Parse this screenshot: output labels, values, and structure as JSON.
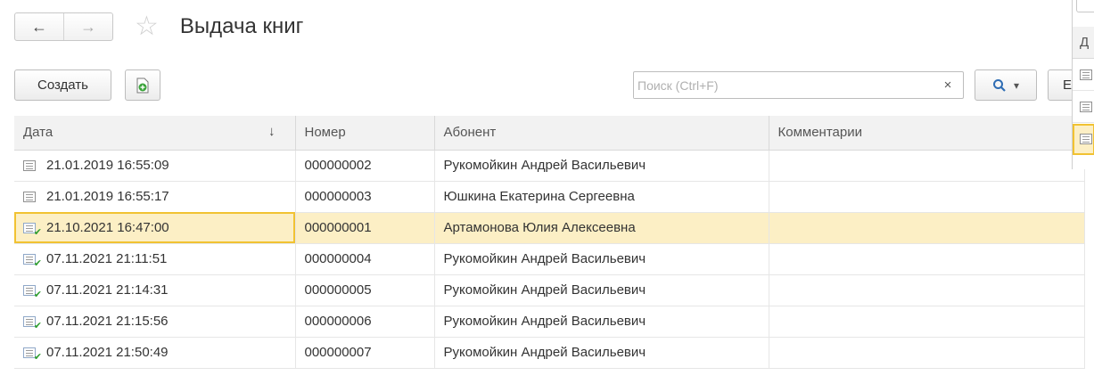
{
  "window": {
    "title": "Выдача книг",
    "back_glyph": "←",
    "forward_glyph": "→",
    "star_glyph": "☆"
  },
  "toolbar": {
    "create_label": "Создать",
    "search_placeholder": "Поиск (Ctrl+F)",
    "search_value": "",
    "clear_glyph": "×",
    "find_glyph": "🔍",
    "dropdown_glyph": "▾",
    "more_label": "Eu"
  },
  "table": {
    "columns": [
      "Дата",
      "Номер",
      "Абонент",
      "Комментарии"
    ],
    "sort_glyph": "↓",
    "rows": [
      {
        "date": "21.01.2019 16:55:09",
        "number": "000000002",
        "subscriber": "Рукомойкин Андрей Васильевич",
        "comment": "",
        "posted": false,
        "selected": false
      },
      {
        "date": "21.01.2019 16:55:17",
        "number": "000000003",
        "subscriber": "Юшкина Екатерина Сергеевна",
        "comment": "",
        "posted": false,
        "selected": false
      },
      {
        "date": "21.10.2021 16:47:00",
        "number": "000000001",
        "subscriber": "Артамонова Юлия Алексеевна",
        "comment": "",
        "posted": true,
        "selected": true
      },
      {
        "date": "07.11.2021 21:11:51",
        "number": "000000004",
        "subscriber": "Рукомойкин Андрей Васильевич",
        "comment": "",
        "posted": true,
        "selected": false
      },
      {
        "date": "07.11.2021 21:14:31",
        "number": "000000005",
        "subscriber": "Рукомойкин Андрей Васильевич",
        "comment": "",
        "posted": true,
        "selected": false
      },
      {
        "date": "07.11.2021 21:15:56",
        "number": "000000006",
        "subscriber": "Рукомойкин Андрей Васильевич",
        "comment": "",
        "posted": true,
        "selected": false
      },
      {
        "date": "07.11.2021 21:50:49",
        "number": "000000007",
        "subscriber": "Рукомойкин Андрей Васильевич",
        "comment": "",
        "posted": true,
        "selected": false
      }
    ]
  },
  "side_panel": {
    "header": "Д"
  },
  "colors": {
    "selected_row": "#fcefc5",
    "selected_border": "#f1c232",
    "header_bg": "#f2f2f2"
  }
}
